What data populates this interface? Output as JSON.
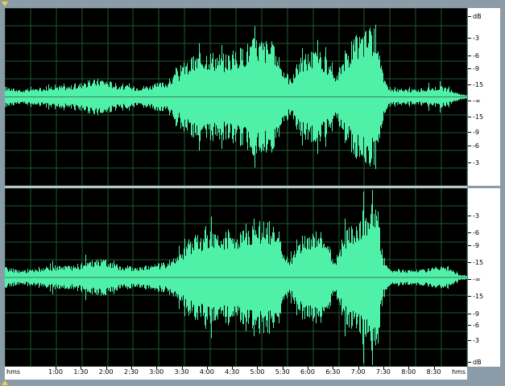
{
  "colors": {
    "waveform": "#4ff0a8",
    "grid": "#1f5a2c",
    "background": "#000000",
    "centerline": "#3a8060"
  },
  "db_ruler_top": {
    "labels": [
      "dB",
      "-3",
      "-6",
      "-9",
      "-15",
      "-∞",
      "-15",
      "-9",
      "-6",
      "-3"
    ]
  },
  "db_ruler_bottom": {
    "labels": [
      "-3",
      "-6",
      "-9",
      "-15",
      "-∞",
      "-15",
      "-9",
      "-6",
      "-3",
      "dB"
    ]
  },
  "time_ruler": {
    "unit_left": "hms",
    "unit_right": "hms",
    "ticks": [
      "1:00",
      "1:30",
      "2:00",
      "2:30",
      "3:00",
      "3:30",
      "4:00",
      "4:30",
      "5:00",
      "5:30",
      "6:00",
      "6:30",
      "7:00",
      "7:30",
      "8:00",
      "8:30"
    ]
  },
  "icons": {
    "play_marker_top": "triangle-down-icon",
    "play_marker_bottom": "triangle-up-icon"
  }
}
